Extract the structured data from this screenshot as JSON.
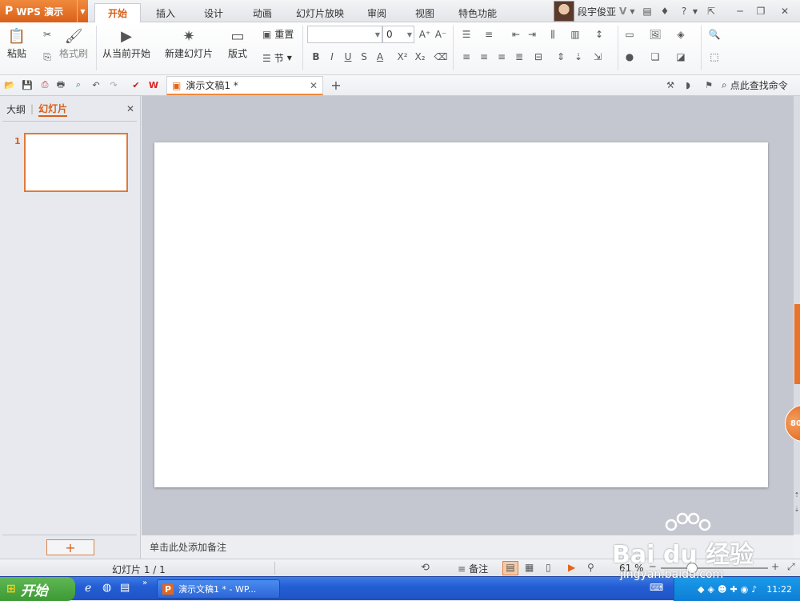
{
  "app": {
    "name": "WPS 演示",
    "logo": "P"
  },
  "tabs": [
    "开始",
    "插入",
    "设计",
    "动画",
    "幻灯片放映",
    "审阅",
    "视图",
    "特色功能"
  ],
  "user": {
    "name": "段宇俊亚",
    "badge": "V"
  },
  "ribbon": {
    "paste": "粘贴",
    "format_painter": "格式刷",
    "play_from_current": "从当前开始",
    "new_slide": "新建幻灯片",
    "layout": "版式",
    "reset": "重置",
    "section": "节",
    "font_size": "0"
  },
  "document": {
    "tab_title": "演示文稿1 *"
  },
  "search_command": "点此查找命令",
  "panel": {
    "outline_tab": "大纲",
    "slides_tab": "幻灯片",
    "slide_number": "1"
  },
  "notes_placeholder": "单击此处添加备注",
  "status": {
    "slide_counter": "幻灯片 1 / 1",
    "notes_button": "备注",
    "zoom": "61 %"
  },
  "taskbar": {
    "start": "开始",
    "window_title": "演示文稿1 * - WP...",
    "time": "11:22"
  },
  "side_badge": "80",
  "watermark": {
    "brand": "Bai du 经验",
    "url": "jingyan.baidu.com"
  },
  "colors": {
    "accent": "#e2661c",
    "taskbar": "#245ed4",
    "start": "#3c9a34"
  }
}
